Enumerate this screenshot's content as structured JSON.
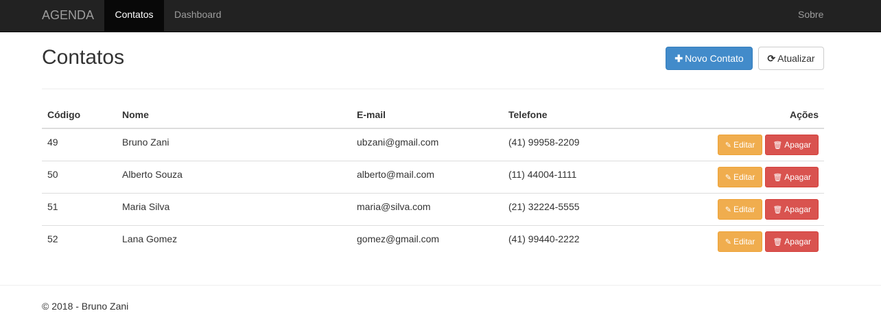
{
  "navbar": {
    "brand": "AGENDA",
    "items": [
      {
        "label": "Contatos",
        "active": true
      },
      {
        "label": "Dashboard",
        "active": false
      }
    ],
    "right_item": "Sobre"
  },
  "page": {
    "title": "Contatos",
    "new_button": {
      "icon": "plus-icon",
      "label": "Novo Contato"
    },
    "refresh_button": {
      "icon": "refresh-icon",
      "label": "Atualizar"
    }
  },
  "table": {
    "headers": {
      "codigo": "Código",
      "nome": "Nome",
      "email": "E-mail",
      "telefone": "Telefone",
      "acoes": "Ações"
    },
    "rows": [
      {
        "codigo": "49",
        "nome": "Bruno Zani",
        "email": "ubzani@gmail.com",
        "telefone": "(41) 99958-2209"
      },
      {
        "codigo": "50",
        "nome": "Alberto Souza",
        "email": "alberto@mail.com",
        "telefone": "(11) 44004-1111"
      },
      {
        "codigo": "51",
        "nome": "Maria Silva",
        "email": "maria@silva.com",
        "telefone": "(21) 32224-5555"
      },
      {
        "codigo": "52",
        "nome": "Lana Gomez",
        "email": "gomez@gmail.com",
        "telefone": "(41) 99440-2222"
      }
    ],
    "edit_label": "Editar",
    "delete_label": "Apagar",
    "edit_icon": "pencil-icon",
    "delete_icon": "trash-icon"
  },
  "footer": {
    "text": "© 2018 - Bruno Zani"
  },
  "colors": {
    "navbar_bg": "#222222",
    "primary": "#428bca",
    "warning": "#f0ad4e",
    "danger": "#d9534f"
  }
}
